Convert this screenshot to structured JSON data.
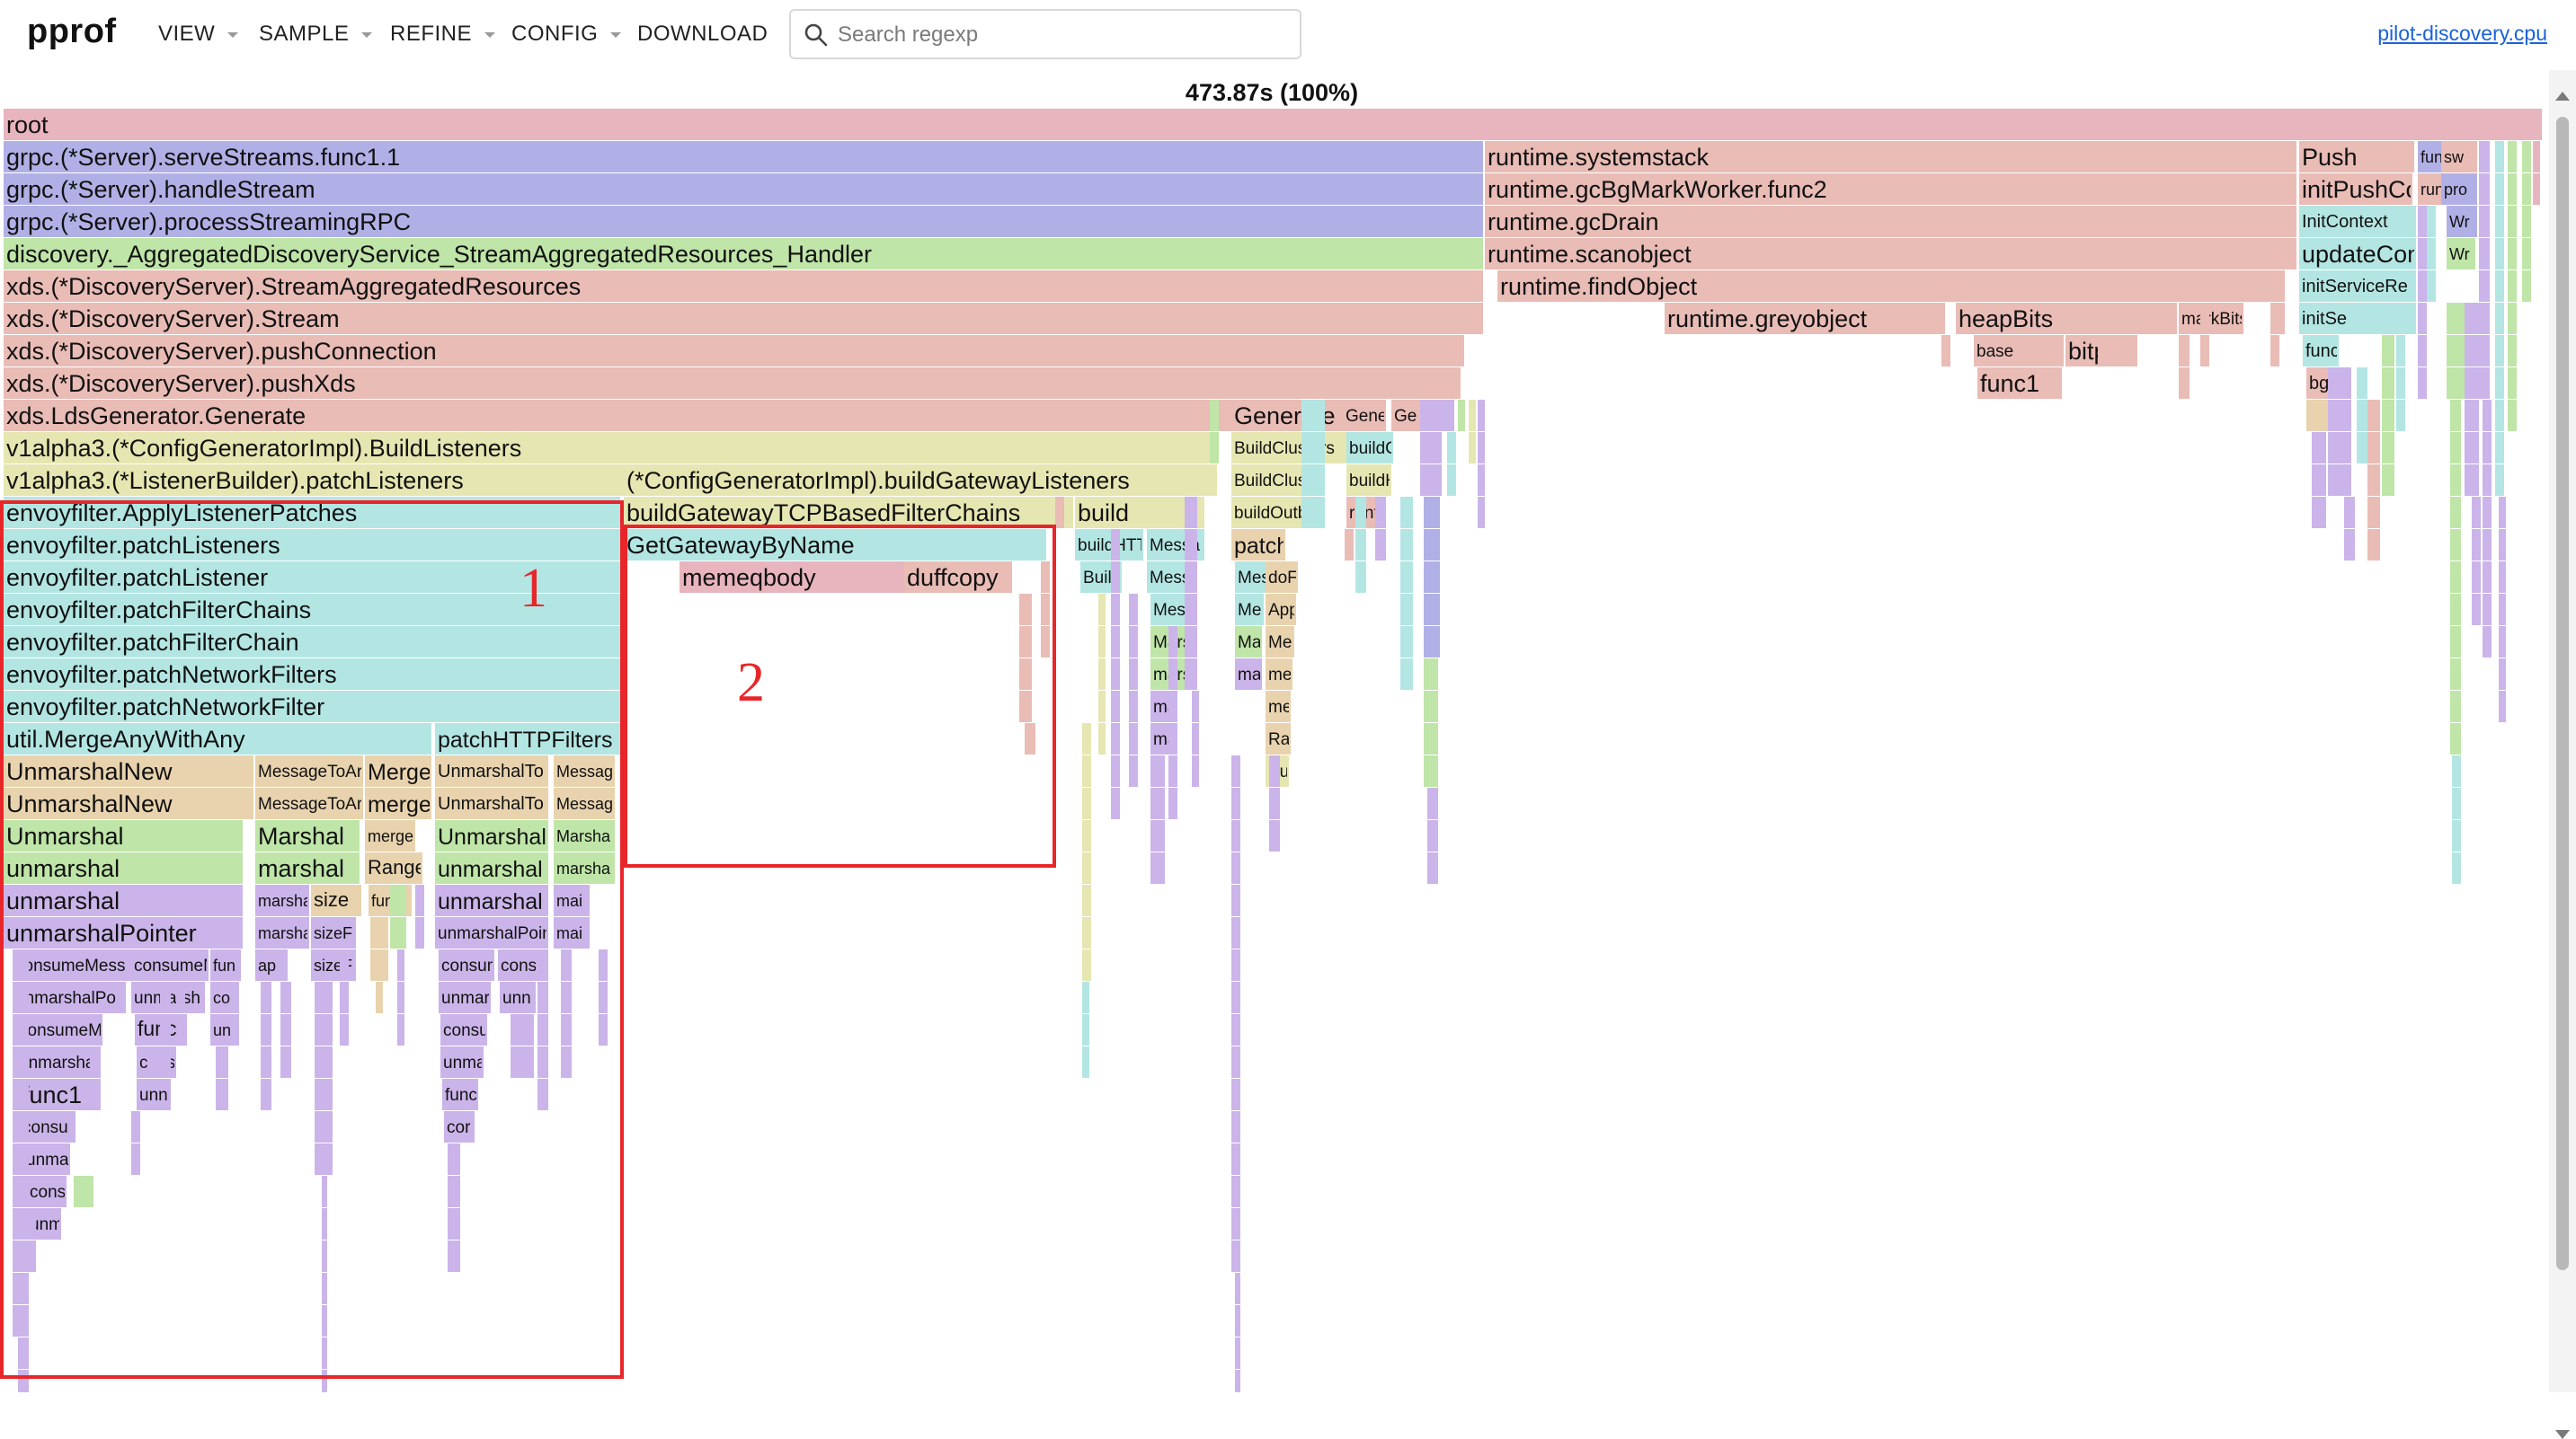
{
  "header": {
    "brand": "pprof",
    "menu": [
      {
        "label": "VIEW",
        "dropdown": true
      },
      {
        "label": "SAMPLE",
        "dropdown": true
      },
      {
        "label": "REFINE",
        "dropdown": true
      },
      {
        "label": "CONFIG",
        "dropdown": true
      },
      {
        "label": "DOWNLOAD",
        "dropdown": false
      }
    ],
    "search": {
      "placeholder": "Search regexp",
      "value": ""
    },
    "profile_name": "pilot-discovery.cpu"
  },
  "graph": {
    "total": "473.87s (100%)",
    "colors": {
      "pink": "#e8b4bd",
      "salmon": "#e9bcb6",
      "violet": "#b1b0e6",
      "green": "#bfe5a8",
      "olive": "#e6e6b2",
      "cyan": "#b3e6e3",
      "tan": "#e8d3ae",
      "lilac": "#cbb4e9",
      "gray": "#cfcfcf"
    },
    "frames": [
      [
        "root",
        "pink"
      ],
      [
        "grpc.(*Server).serveStreams.func1.1",
        "violet"
      ],
      [
        "grpc.(*Server).handleStream",
        "violet"
      ],
      [
        "grpc.(*Server).processStreamingRPC",
        "violet"
      ],
      [
        "discovery._AggregatedDiscoveryService_StreamAggregatedResources_Handler",
        "green"
      ],
      [
        "xds.(*DiscoveryServer).StreamAggregatedResources",
        "salmon"
      ],
      [
        "xds.(*DiscoveryServer).Stream",
        "salmon"
      ],
      [
        "xds.(*DiscoveryServer).pushConnection",
        "salmon"
      ],
      [
        "xds.(*DiscoveryServer).pushXds",
        "salmon"
      ],
      [
        "xds.LdsGenerator.Generate",
        "salmon"
      ],
      [
        "v1alpha3.(*ConfigGeneratorImpl).BuildListeners",
        "olive"
      ],
      [
        "v1alpha3.(*ListenerBuilder).patchListeners",
        "olive"
      ],
      [
        "envoyfilter.ApplyListenerPatches",
        "cyan"
      ],
      [
        "envoyfilter.patchListeners",
        "cyan"
      ],
      [
        "envoyfilter.patchListener",
        "cyan"
      ],
      [
        "envoyfilter.patchFilterChains",
        "cyan"
      ],
      [
        "envoyfilter.patchFilterChain",
        "cyan"
      ],
      [
        "envoyfilter.patchNetworkFilters",
        "cyan"
      ],
      [
        "envoyfilter.patchNetworkFilter",
        "cyan"
      ],
      [
        "util.MergeAnyWithAny",
        "cyan"
      ],
      [
        "UnmarshalNew",
        "tan"
      ],
      [
        "UnmarshalNew",
        "tan"
      ],
      [
        "Unmarshal",
        "green"
      ],
      [
        "unmarshal",
        "green"
      ],
      [
        "unmarshal",
        "lilac"
      ],
      [
        "unmarshalPointer",
        "lilac"
      ],
      [
        "consumeMess",
        "lilac"
      ],
      [
        "unmarshalPo",
        "lilac"
      ],
      [
        "consumeM",
        "lilac"
      ],
      [
        "unmarsha",
        "lilac"
      ],
      [
        "func1",
        "lilac"
      ],
      [
        "consu",
        "lilac"
      ],
      [
        "unma",
        "lilac"
      ],
      [
        "cons",
        "lilac"
      ],
      [
        "unm",
        "lilac"
      ],
      [
        "MessageToAr",
        "tan"
      ],
      [
        "MessageToAr",
        "tan"
      ],
      [
        "Marshal",
        "green"
      ],
      [
        "marshal",
        "green"
      ],
      [
        "marsha",
        "lilac"
      ],
      [
        "marsha",
        "lilac"
      ],
      [
        "ap",
        "lilac"
      ],
      [
        "consumeM",
        "lilac"
      ],
      [
        "unmarsh",
        "lilac"
      ],
      [
        "func1",
        "lilac"
      ],
      [
        "cons",
        "lilac"
      ],
      [
        "unn",
        "lilac"
      ],
      [
        "fun",
        "lilac"
      ],
      [
        "cor",
        "lilac"
      ],
      [
        "uni",
        "lilac"
      ],
      [
        "size",
        "tan"
      ],
      [
        "sizeF",
        "lilac"
      ],
      [
        "sizeF",
        "lilac"
      ],
      [
        "Merge",
        "tan"
      ],
      [
        "merge",
        "tan"
      ],
      [
        "mergeM",
        "tan"
      ],
      [
        "Range",
        "tan"
      ],
      [
        "func",
        "tan"
      ],
      [
        "patchHTTPFilters",
        "cyan"
      ],
      [
        "UnmarshalTo",
        "tan"
      ],
      [
        "UnmarshalTo",
        "tan"
      ],
      [
        "Unmarshal",
        "green"
      ],
      [
        "unmarshal",
        "green"
      ],
      [
        "unmarshal",
        "lilac"
      ],
      [
        "unmarshalPoin",
        "lilac"
      ],
      [
        "consum",
        "lilac"
      ],
      [
        "unmar",
        "lilac"
      ],
      [
        "consu",
        "lilac"
      ],
      [
        "unma",
        "lilac"
      ],
      [
        "func",
        "lilac"
      ],
      [
        "cor",
        "lilac"
      ],
      [
        "cons",
        "lilac"
      ],
      [
        "unn",
        "lilac"
      ],
      [
        "Messag",
        "tan"
      ],
      [
        "Messag",
        "tan"
      ],
      [
        "Marsha",
        "green"
      ],
      [
        "marsha",
        "green"
      ],
      [
        "mai",
        "lilac"
      ],
      [
        "mai",
        "lilac"
      ],
      [
        "(*ConfigGeneratorImpl).buildGatewayListeners",
        "olive"
      ],
      [
        "buildGatewayTCPBasedFilterChains",
        "olive"
      ],
      [
        "GetGatewayByName",
        "cyan"
      ],
      [
        "memeqbody",
        "pink"
      ],
      [
        "duffcopy",
        "salmon"
      ],
      [
        "build",
        "olive"
      ],
      [
        "buildHTT",
        "cyan"
      ],
      [
        "Builc",
        "cyan"
      ],
      [
        "Messa",
        "cyan"
      ],
      [
        "Messa",
        "cyan"
      ],
      [
        "Messa",
        "cyan"
      ],
      [
        "Marsh",
        "green"
      ],
      [
        "marsh",
        "green"
      ],
      [
        "ma",
        "lilac"
      ],
      [
        "ma",
        "lilac"
      ],
      [
        "Generate",
        "salmon"
      ],
      [
        "Gene",
        "salmon"
      ],
      [
        "Ge",
        "salmon"
      ],
      [
        "BuildClusters",
        "olive"
      ],
      [
        "BuildClustei",
        "olive"
      ],
      [
        "buildOutbo",
        "olive"
      ],
      [
        "patch",
        "tan"
      ],
      [
        "Mes",
        "cyan"
      ],
      [
        "doF",
        "tan"
      ],
      [
        "Mes",
        "cyan"
      ],
      [
        "App",
        "tan"
      ],
      [
        "Mai",
        "green"
      ],
      [
        "Me",
        "tan"
      ],
      [
        "mai",
        "lilac"
      ],
      [
        "me",
        "tan"
      ],
      [
        "me",
        "tan"
      ],
      [
        "Ra",
        "tan"
      ],
      [
        "BuildH",
        "olive"
      ],
      [
        "buildC",
        "cyan"
      ],
      [
        "buildH",
        "olive"
      ],
      [
        "runtime.gcBgMarkWorker",
        "salmon"
      ],
      [
        "runtime.systemstack",
        "salmon"
      ],
      [
        "runtime.gcBgMarkWorker.func2",
        "salmon"
      ],
      [
        "runtime.gcDrain",
        "salmon"
      ],
      [
        "runtime.scanobject",
        "salmon"
      ],
      [
        "runtime.findObject",
        "salmon"
      ],
      [
        "runtime.greyobject",
        "salmon"
      ],
      [
        "heapBits",
        "salmon"
      ],
      [
        "markBitsF",
        "salmon"
      ],
      [
        "base",
        "salmon"
      ],
      [
        "bitp",
        "salmon"
      ],
      [
        "func1",
        "salmon"
      ],
      [
        "Push",
        "salmon"
      ],
      [
        "initPushContex",
        "salmon"
      ],
      [
        "InitContext",
        "cyan"
      ],
      [
        "updateContext",
        "cyan"
      ],
      [
        "initServiceRe",
        "cyan"
      ],
      [
        "initSe",
        "cyan"
      ],
      [
        "func",
        "cyan"
      ],
      [
        "bgs",
        "salmon"
      ],
      [
        "fun",
        "violet"
      ],
      [
        "sw",
        "salmon"
      ],
      [
        "run",
        "salmon"
      ],
      [
        "pro",
        "violet"
      ],
      [
        "Wr",
        "violet"
      ],
      [
        "Wr",
        "green"
      ]
    ]
  },
  "annotations": [
    "1",
    "2"
  ]
}
